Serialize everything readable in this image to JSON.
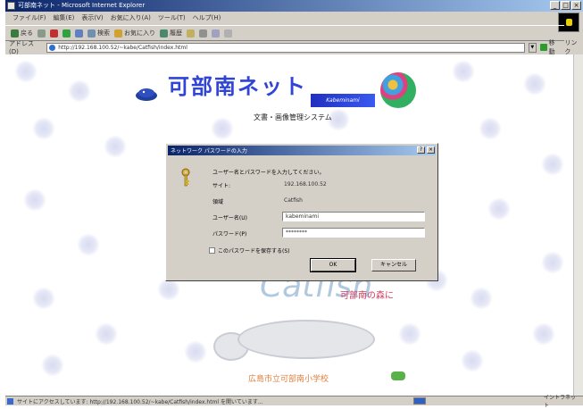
{
  "window": {
    "title": "可部南ネット - Microsoft Internet Explorer",
    "controls": [
      "_",
      "□",
      "×"
    ]
  },
  "menubar": {
    "items": [
      "ファイル(F)",
      "編集(E)",
      "表示(V)",
      "お気に入り(A)",
      "ツール(T)",
      "ヘルプ(H)"
    ]
  },
  "toolbar": {
    "back_label": "戻る",
    "forward_label": "",
    "search_label": "検索",
    "favorites_label": "お気に入り",
    "history_label": "履歴"
  },
  "address": {
    "label": "アドレス(D)",
    "url": "http://192.168.100.52/~kabe/Catfish/index.html",
    "go_label": "移動",
    "links_label": "リンク"
  },
  "page": {
    "site_title": "可部南ネット",
    "badge_text": "Kabeminami",
    "subtitle": "文書・画像管理システム",
    "lower_pink_text": "可部南の森に",
    "bottom_text": "広島市立可部南小学校"
  },
  "dialog": {
    "title": "ネットワーク パスワードの入力",
    "help": "?",
    "close": "×",
    "prompt": "ユーザー名とパスワードを入力してください。",
    "site_label": "サイト:",
    "site_value": "192.168.100.52",
    "realm_label": "領域",
    "realm_value": "Catfish",
    "username_label": "ユーザー名(U)",
    "username_value": "kabeminami",
    "password_label": "パスワード(P)",
    "password_value": "********",
    "save_password_label": "このパスワードを保存する(S)",
    "ok_label": "OK",
    "cancel_label": "キャンセル"
  },
  "status": {
    "text": "サイトにアクセスしています: http://192.168.100.52/~kabe/Catfish/index.html を開いています...",
    "zone": "イントラネット"
  },
  "colors": {
    "titlebar": "#0a246a",
    "site_title": "#3045d8",
    "bottom_text": "#e08040"
  }
}
